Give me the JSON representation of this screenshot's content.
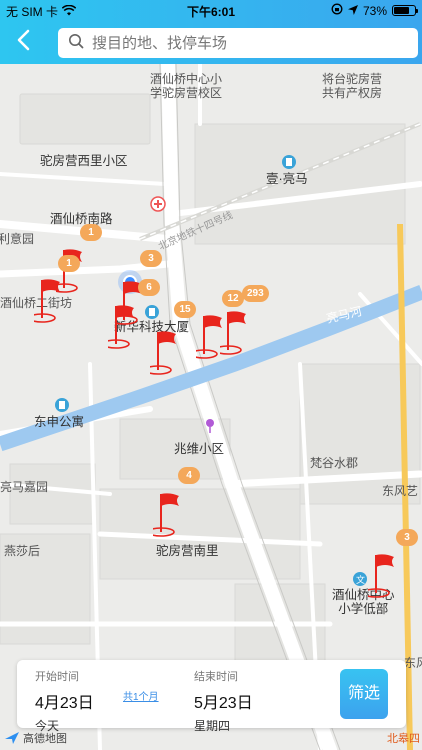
{
  "status": {
    "carrier": "无 SIM 卡",
    "time": "下午6:01",
    "battery_text": "73%",
    "battery_level": 0.73
  },
  "header": {
    "back_icon": "chevron-left-icon",
    "search_placeholder": "搜目的地、找停车场"
  },
  "map": {
    "labels": {
      "school_top": "酒仙桥中心小\n学驼房营校区",
      "jiangtai_village": "将台驼房营\n共有产权房",
      "tuofangying_west": "驼房营西里小区",
      "yiliangma": "壹·亮马",
      "jiuxianqiao_south_road": "酒仙桥南路",
      "yiyuan": "利意园",
      "jiuxianqiao_street": "酒仙桥二街坊",
      "xinhua_building": "新华科技大厦",
      "liangma_river": "亮马河",
      "dongshen_apartment": "东申公寓",
      "zhaowei": "兆维小区",
      "fangu": "梵谷水郡",
      "liangma_jiayuan": "亮马嘉园",
      "dongfeng": "东风艺",
      "tuofangying_south": "驼房营南里",
      "yanshahou": "燕莎后",
      "school_bottom": "酒仙桥中心\n小学低部",
      "dongyan": "东风",
      "rail_line": "北京地铁十四号线"
    },
    "markers": [
      {
        "count": "1"
      },
      {
        "count": "1"
      },
      {
        "count": "3"
      },
      {
        "count": "6"
      },
      {
        "count": "15"
      },
      {
        "count": "12"
      },
      {
        "count": "293"
      },
      {
        "count": "4"
      },
      {
        "count": "3"
      }
    ]
  },
  "booking": {
    "start_caption": "开始时间",
    "start_date": "4月23日",
    "start_day": "今天",
    "duration": "共1个月",
    "end_caption": "结束时间",
    "end_date": "5月23日",
    "end_day": "星期四",
    "filter_label": "筛选"
  },
  "footer": {
    "logo_text": "高德地图",
    "corner_text": "北皋四"
  },
  "colors": {
    "header_start": "#2ec6f0",
    "header_end": "#3aa6ee",
    "flag": "#e8251d",
    "badge": "#f4a85a",
    "river": "#9ec9f0"
  }
}
